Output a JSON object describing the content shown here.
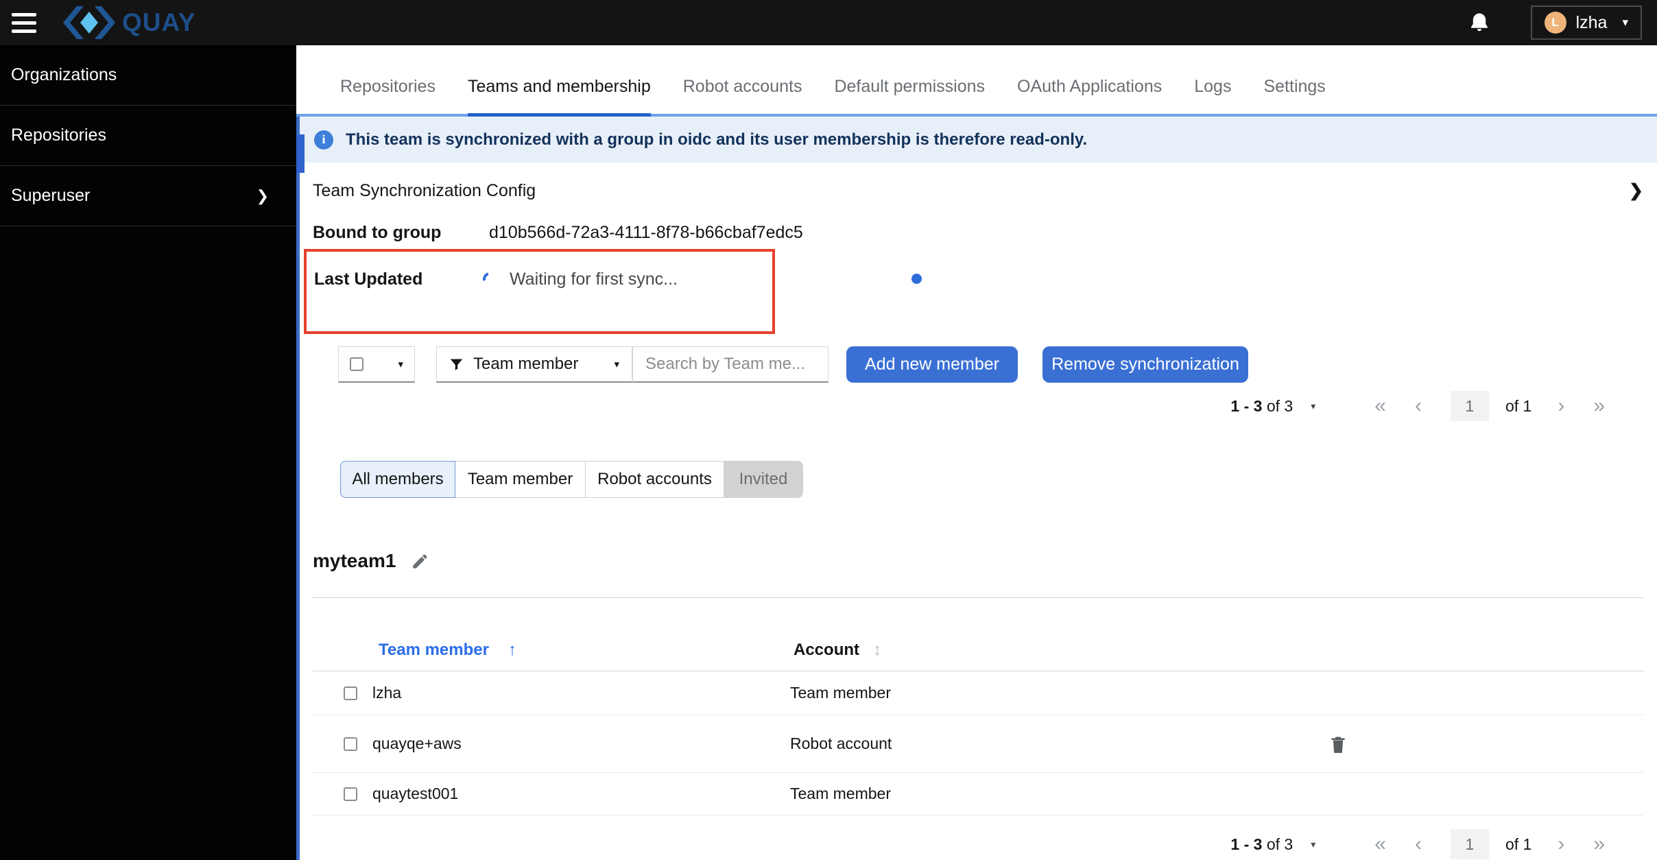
{
  "header": {
    "brand": "QUAY",
    "user": {
      "initial": "L",
      "name": "lzha"
    }
  },
  "sidebar": {
    "items": [
      {
        "label": "Organizations"
      },
      {
        "label": "Repositories"
      },
      {
        "label": "Superuser",
        "chevron": "❯"
      }
    ]
  },
  "tabs": [
    {
      "label": "Repositories"
    },
    {
      "label": "Teams and membership"
    },
    {
      "label": "Robot accounts"
    },
    {
      "label": "Default permissions"
    },
    {
      "label": "OAuth Applications"
    },
    {
      "label": "Logs"
    },
    {
      "label": "Settings"
    }
  ],
  "alert": {
    "icon": "i",
    "text": "This team is synchronized with a group in oidc and its user membership is therefore read-only."
  },
  "sync": {
    "title": "Team Synchronization Config",
    "expand_chevron": "❯",
    "bound_label": "Bound to group",
    "bound_value": "d10b566d-72a3-4111-8f78-b66cbaf7edc5",
    "last_updated_label": "Last Updated",
    "last_updated_value": "Waiting for first sync..."
  },
  "toolbar": {
    "filter_label": "Team member",
    "search_placeholder": "Search by Team me...",
    "add_button": "Add new member",
    "remove_button": "Remove synchronization"
  },
  "pagination": {
    "range_strong": "1 - 3",
    "range_rest": "of 3",
    "caret": "▾",
    "first": "«",
    "prev": "‹",
    "page": "1",
    "of_pages": "of 1",
    "next": "›",
    "last": "»"
  },
  "view_toggle": [
    {
      "label": "All members",
      "state": "selected"
    },
    {
      "label": "Team member",
      "state": "default"
    },
    {
      "label": "Robot accounts",
      "state": "default"
    },
    {
      "label": "Invited",
      "state": "disabled"
    }
  ],
  "team": {
    "name": "myteam1"
  },
  "table": {
    "columns": {
      "member": "Team member",
      "account": "Account"
    },
    "sort_asc_icon": "↑",
    "sort_both_icon": "↕",
    "rows": [
      {
        "name": "lzha",
        "account": "Team member"
      },
      {
        "name": "quayqe+aws",
        "account": "Robot account"
      },
      {
        "name": "quaytest001",
        "account": "Team member"
      }
    ]
  },
  "glyphs": {
    "caret_down": "▾"
  },
  "colors": {
    "primary_button": "#3a70d4",
    "active_tab_underline": "#2264c9",
    "tabbar_line": "#6fa1ea",
    "alert_bg": "#e7eff9",
    "annotation_red": "#e8402a",
    "link_blue": "#2b6de8",
    "header_bg": "#141414",
    "avatar_bg": "#efb479",
    "selected_toggle_bg": "#e8f0fb",
    "disabled_toggle_bg": "#d2d2d2"
  }
}
